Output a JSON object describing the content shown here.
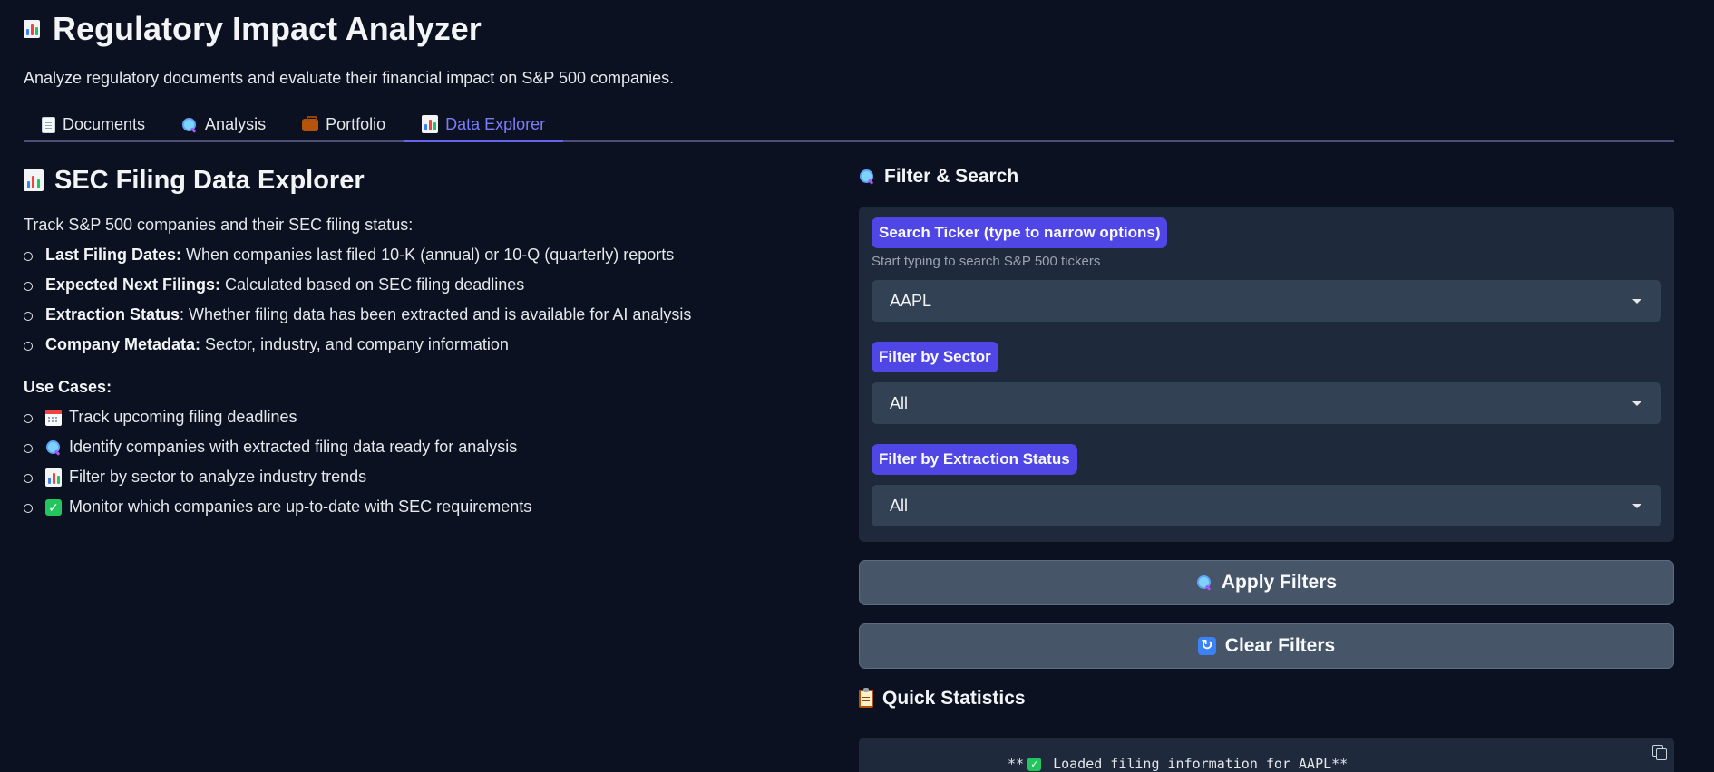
{
  "header": {
    "title": "Regulatory Impact Analyzer",
    "subtitle": "Analyze regulatory documents and evaluate their financial impact on S&P 500 companies."
  },
  "tabs": [
    {
      "label": "Documents",
      "icon": "document-icon",
      "active": false
    },
    {
      "label": "Analysis",
      "icon": "search-icon",
      "active": false
    },
    {
      "label": "Portfolio",
      "icon": "briefcase-icon",
      "active": false
    },
    {
      "label": "Data Explorer",
      "icon": "bar-chart-icon",
      "active": true
    }
  ],
  "left": {
    "title": "SEC Filing Data Explorer",
    "intro": "Track S&P 500 companies and their SEC filing status:",
    "features": [
      {
        "term": "Last Filing Dates:",
        "text": " When companies last filed 10-K (annual) or 10-Q (quarterly) reports"
      },
      {
        "term": "Expected Next Filings:",
        "text": " Calculated based on SEC filing deadlines"
      },
      {
        "term": "Extraction Status",
        "text": ": Whether filing data has been extracted and is available for AI analysis"
      },
      {
        "term": "Company Metadata:",
        "text": " Sector, industry, and company information"
      }
    ],
    "use_cases_title": "Use Cases:",
    "use_cases": [
      {
        "icon": "calendar-icon",
        "text": "Track upcoming filing deadlines"
      },
      {
        "icon": "search-icon",
        "text": "Identify companies with extracted filing data ready for analysis"
      },
      {
        "icon": "bar-chart-icon",
        "text": "Filter by sector to analyze industry trends"
      },
      {
        "icon": "check-icon",
        "text": "Monitor which companies are up-to-date with SEC requirements"
      }
    ]
  },
  "filters": {
    "title": "Filter & Search",
    "ticker_label": "Search Ticker (type to narrow options)",
    "ticker_hint": "Start typing to search S&P 500 tickers",
    "ticker_value": "AAPL",
    "sector_label": "Filter by Sector",
    "sector_value": "All",
    "status_label": "Filter by Extraction Status",
    "status_value": "All",
    "apply_label": "Apply Filters",
    "clear_label": "Clear Filters"
  },
  "stats": {
    "title": "Quick Statistics",
    "line_prefix": "**",
    "line_text": " Loaded filing information for AAPL**"
  },
  "colors": {
    "background": "#0b1120",
    "accent": "#6366f1",
    "chip": "#4f46e5",
    "panel": "#1e293b"
  }
}
